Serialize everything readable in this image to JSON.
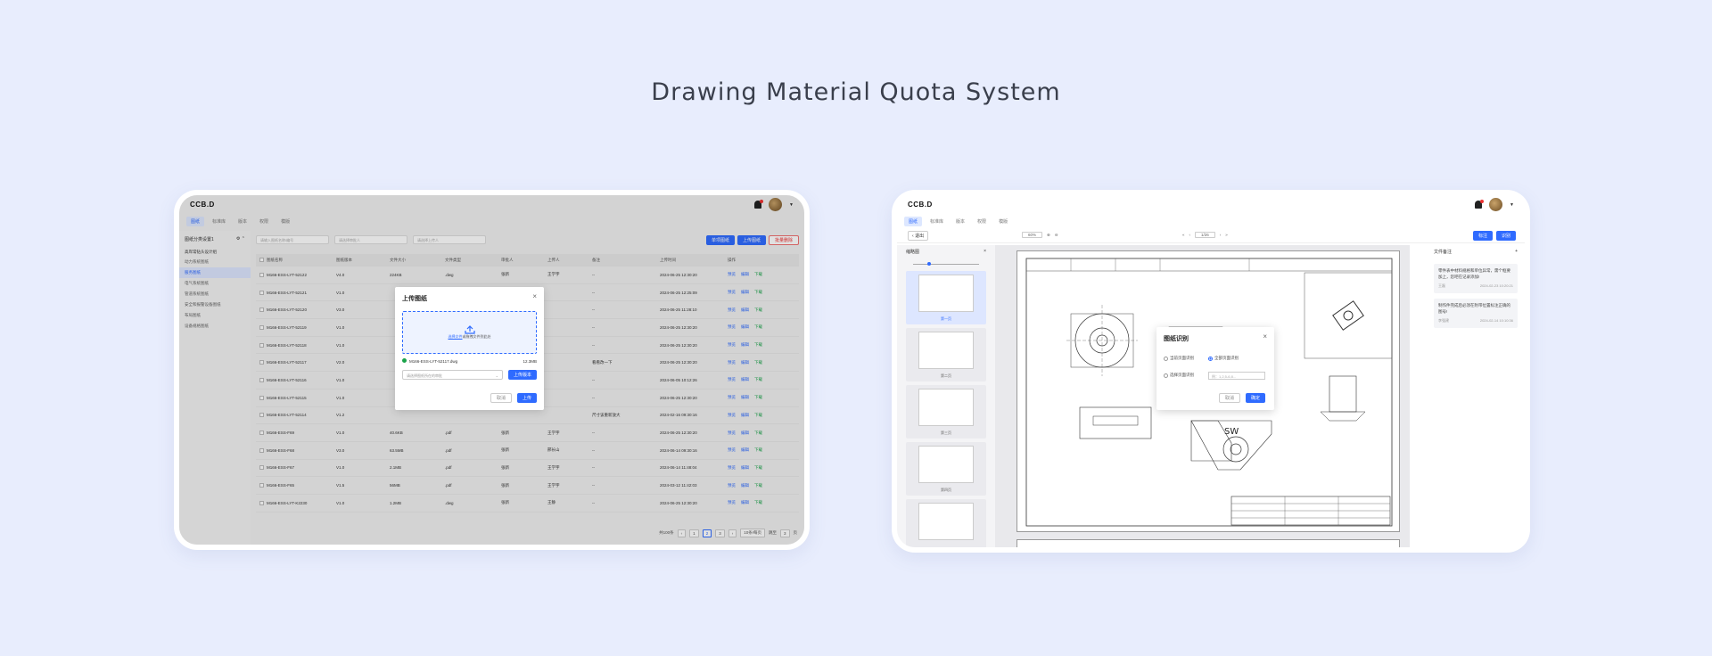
{
  "headline": "Drawing Material Quota System",
  "colors": {
    "background": "#e8edfd",
    "accent": "#2f6bff",
    "danger": "#e33333",
    "success": "#1aa34a"
  },
  "app": {
    "logo": "CCB.D",
    "nav_tabs": [
      "图纸",
      "标准库",
      "版本",
      "权限",
      "模版"
    ]
  },
  "screen1": {
    "sidebar": {
      "header": "图纸分类设置1",
      "group": "高岸常钻头设计组",
      "items": [
        "动力系统图纸",
        "服务图纸",
        "电气系统图纸",
        "管道系统图纸",
        "安全和报警设备图纸",
        "布局图纸",
        "设备规格图纸"
      ]
    },
    "search_placeholders": [
      "请输入图纸名称/编号",
      "请选择审批人",
      "请选择上传人"
    ],
    "buttons": {
      "recognize": "单项图纸",
      "upload": "上传图纸",
      "batch_delete": "批量删除"
    },
    "columns": [
      "图纸名称",
      "图纸版本",
      "文件大小",
      "文件类型",
      "审批人",
      "上传人",
      "备注",
      "上传时间",
      "操作"
    ],
    "rows": [
      [
        "M166-ESS-LYT-52122",
        "V4.0",
        "224KB",
        ".dwg",
        "张新",
        "王学宇",
        "--",
        "2024-06-25 12:30:20"
      ],
      [
        "M166-ESS-LYT-52121",
        "V1.0",
        "",
        "",
        "",
        "",
        "--",
        "2024-06-25 12:25:09"
      ],
      [
        "M166-ESS-LYT-52120",
        "V3.0",
        "",
        "",
        "",
        "",
        "--",
        "2024-06-25 11:28:10"
      ],
      [
        "M166-ESS-LYT-52119",
        "V1.0",
        "",
        "",
        "",
        "",
        "--",
        "2024-06-25 12:30:20"
      ],
      [
        "M166-ESS-LYT-52118",
        "V1.0",
        "",
        "",
        "",
        "",
        "--",
        "2024-06-25 12:30:20"
      ],
      [
        "M166-ESS-LYT-52117",
        "V2.0",
        "",
        "",
        "",
        "",
        "看看改一下",
        "2024-06-25 12:30:20"
      ],
      [
        "M166-ESS-LYT-52116",
        "V1.0",
        "",
        "",
        "",
        "",
        "--",
        "2024-06-05 10:12:26"
      ],
      [
        "M166-ESS-LYT-52115",
        "V1.0",
        "",
        "",
        "",
        "",
        "--",
        "2024-06-25 12:30:20"
      ],
      [
        "M166-ESS-LYT-52114",
        "V1.2",
        "",
        "",
        "",
        "",
        "尺寸该重新放大",
        "2024-02-16 09:30:16"
      ],
      [
        "M166-ESS-F69",
        "V1.0",
        "40.6KB",
        ".pdf",
        "张新",
        "王学宇",
        "--",
        "2024-06-25 12:30:20"
      ],
      [
        "M166-ESS-F68",
        "V3.0",
        "63.5MB",
        ".pdf",
        "张新",
        "邢长山",
        "--",
        "2024-06-14 09:30:16"
      ],
      [
        "M166-ESS-F67",
        "V1.0",
        "2.1MB",
        ".pdf",
        "张新",
        "王学宇",
        "--",
        "2024-06-14 11:48:04"
      ],
      [
        "M166-ESS-F65",
        "V1.5",
        "56MB",
        ".pdf",
        "张新",
        "王学宇",
        "--",
        "2024-03-12 11:42:03"
      ],
      [
        "M166-ESS-LYT-K2230",
        "V1.0",
        "1.2MB",
        ".dwg",
        "张新",
        "王静",
        "--",
        "2024-06-25 12:30:20"
      ]
    ],
    "row_ops": [
      "预览",
      "编辑",
      "下载"
    ],
    "pager": {
      "total": "共100条",
      "pages": [
        "1",
        "2",
        "3"
      ],
      "per_page": "10条/每页",
      "goto": "跳至",
      "goto_value": "3",
      "goto_suffix": "页"
    },
    "upload_modal": {
      "title": "上传图纸",
      "drop_link": "选择文件",
      "drop_text": "或拖拽文件到此处",
      "file_name": "M166-ESS-LYT-52117.dwg",
      "file_size": "12.3MB",
      "select_placeholder": "请选择图纸所在的审批",
      "upload_version": "上传版本",
      "cancel": "取消",
      "confirm": "上传"
    }
  },
  "screen2": {
    "back": "退出",
    "zoom_value": "60%",
    "page_value": "1/26",
    "actions": {
      "annotate": "标注",
      "recognize": "识别"
    },
    "thumb_panel": {
      "title": "缩略图",
      "captions": [
        "第一页",
        "第二页",
        "第三页",
        "第四页",
        ""
      ]
    },
    "notes": {
      "title": "文件备注",
      "items": [
        {
          "text": "零件表中材料规格和单位异常，需个框要加上，您吧在记录添加!",
          "author": "王磊",
          "time": "2024-02-23 10:20:21"
        },
        {
          "text": "制作件完成后必须在附带位置标注正确的图号!",
          "author": "李强建",
          "time": "2024-02-14 10:10:36"
        }
      ]
    },
    "recognize_modal": {
      "title": "图纸识别",
      "opt_current": "当前页面识别",
      "opt_all": "全部页面识别",
      "opt_select": "选择页面识别",
      "input_placeholder": "例：1,2,5-6,8...",
      "cancel": "取消",
      "confirm": "确定"
    },
    "drawing_labels": {
      "sw": "SW"
    }
  }
}
